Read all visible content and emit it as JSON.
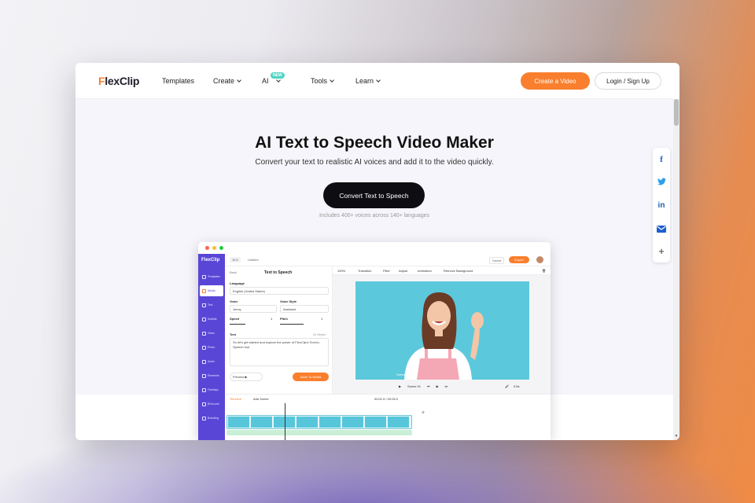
{
  "nav": {
    "logo": {
      "mark": "F",
      "text": "lexClip"
    },
    "items": [
      "Templates",
      "Create",
      "AI",
      "Tools",
      "Learn"
    ],
    "new_badge": "NEW",
    "create_btn": "Create a Video",
    "login_btn": "Login / Sign Up"
  },
  "hero": {
    "title": "AI Text to Speech Video Maker",
    "subtitle": "Convert your text to realistic AI voices and add it to the video quickly.",
    "cta": "Convert Text to Speech",
    "note": "Includes 400+ voices across 140+ languages"
  },
  "share": {
    "icons": [
      "facebook-icon",
      "twitter-icon",
      "linkedin-icon",
      "email-icon",
      "plus-icon"
    ]
  },
  "colors": {
    "accent": "#f97f2e",
    "brand_purple": "#5a46d6",
    "dark": "#0e0e12"
  },
  "editor": {
    "logo": "FlexClip",
    "ratio": "16:9",
    "file": "Untitled",
    "saved": "Saved",
    "export": "Export",
    "sidebar": [
      "Templates",
      "Media",
      "Text",
      "Subtitle",
      "Video",
      "Photo",
      "Audio",
      "Elements",
      "Overlays",
      "BGsound",
      "Branding"
    ],
    "panel": {
      "back": "Back",
      "title": "Text to Speech",
      "language_label": "Language",
      "language_value": "English (United States)",
      "voice_label": "Voice",
      "voice_value": "Jenny",
      "style_label": "Voice Style",
      "style_value": "Assistant",
      "speed_label": "Speed",
      "speed_value": "1",
      "pitch_label": "Pitch",
      "pitch_value": "1",
      "text_label": "Text",
      "text_link": "AI Helper",
      "text_value": "So let's get started and explore the power of FlexClip's Text-to-Speech tool.",
      "preview": "Preview",
      "save": "Save To Media"
    },
    "toolbar": [
      "100%",
      "Transition",
      "Filter",
      "Adjust",
      "Animation",
      "Remove Background"
    ],
    "player": {
      "scene": "Scene 01",
      "time": "0:5s"
    },
    "timeline": {
      "tab": "Timeline",
      "add_scene": "Add Scene",
      "time": "00:01.5 / 00:05.0"
    }
  }
}
